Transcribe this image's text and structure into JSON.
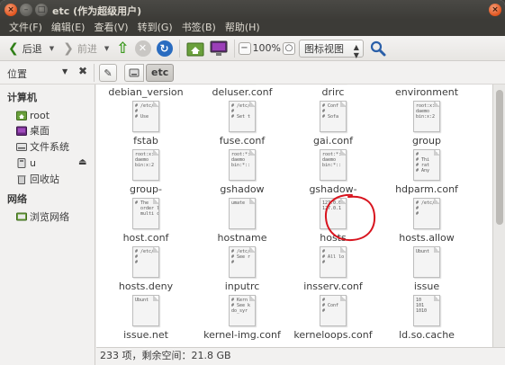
{
  "window": {
    "title": "etc (作为超级用户)"
  },
  "menubar": [
    "文件(F)",
    "编辑(E)",
    "查看(V)",
    "转到(G)",
    "书签(B)",
    "帮助(H)"
  ],
  "toolbar": {
    "back_label": "后退",
    "forward_label": "前进",
    "zoom_value": "100%",
    "view_mode": "图标视图"
  },
  "location": {
    "label": "位置",
    "current_folder": "etc"
  },
  "sidebar": {
    "computer_heading": "计算机",
    "computer_items": [
      "root",
      "桌面",
      "文件系统",
      "u",
      "回收站"
    ],
    "network_heading": "网络",
    "network_items": [
      "浏览网络"
    ]
  },
  "files": [
    {
      "name": "debian_version",
      "preview": ""
    },
    {
      "name": "deluser.conf",
      "preview": ""
    },
    {
      "name": "drirc",
      "preview": ""
    },
    {
      "name": "environment",
      "preview": ""
    },
    {
      "name": "fstab",
      "preview": "# /etc/\n#\n# Use"
    },
    {
      "name": "fuse.conf",
      "preview": "# /etc/\n#\n# Set t"
    },
    {
      "name": "gai.conf",
      "preview": "# Conf\n#\n# Sofa"
    },
    {
      "name": "group",
      "preview": "root:x:\ndaemo\nbin:x:2"
    },
    {
      "name": "group-",
      "preview": "root:x:\ndaemo\nbin:x:2"
    },
    {
      "name": "gshadow",
      "preview": "root:*:\ndaemo\nbin:*::"
    },
    {
      "name": "gshadow-",
      "preview": "root:*:\ndaemo\nbin:*::"
    },
    {
      "name": "hdparm.conf",
      "preview": "#\n# Thi\n# rat\n# Any"
    },
    {
      "name": "host.conf",
      "preview": "# The\n  order l\n  multi c"
    },
    {
      "name": "hostname",
      "preview": "umate"
    },
    {
      "name": "hosts",
      "preview": "127.0.0\n127.0.1"
    },
    {
      "name": "hosts.allow",
      "preview": "# /etc/\n#\n#"
    },
    {
      "name": "hosts.deny",
      "preview": "# /etc/\n#\n#"
    },
    {
      "name": "inputrc",
      "preview": "# /etc/\n# See r\n#"
    },
    {
      "name": "insserv.conf",
      "preview": "#\n# All lo\n#"
    },
    {
      "name": "issue",
      "preview": "Ubunt"
    },
    {
      "name": "issue.net",
      "preview": "Ubunt"
    },
    {
      "name": "kernel-img.conf",
      "preview": "# Kern\n# See k\ndo_syr"
    },
    {
      "name": "kerneloops.conf",
      "preview": "#\n# Conf\n#"
    },
    {
      "name": "ld.so.cache",
      "preview": "10\n101\n1010"
    }
  ],
  "status": {
    "text": "233 项，剩余空间：21.8 GB"
  },
  "colors": {
    "titlebar": "#3c3b37",
    "window_bg": "#f2f1f0",
    "annotation_red": "#d8141e"
  }
}
